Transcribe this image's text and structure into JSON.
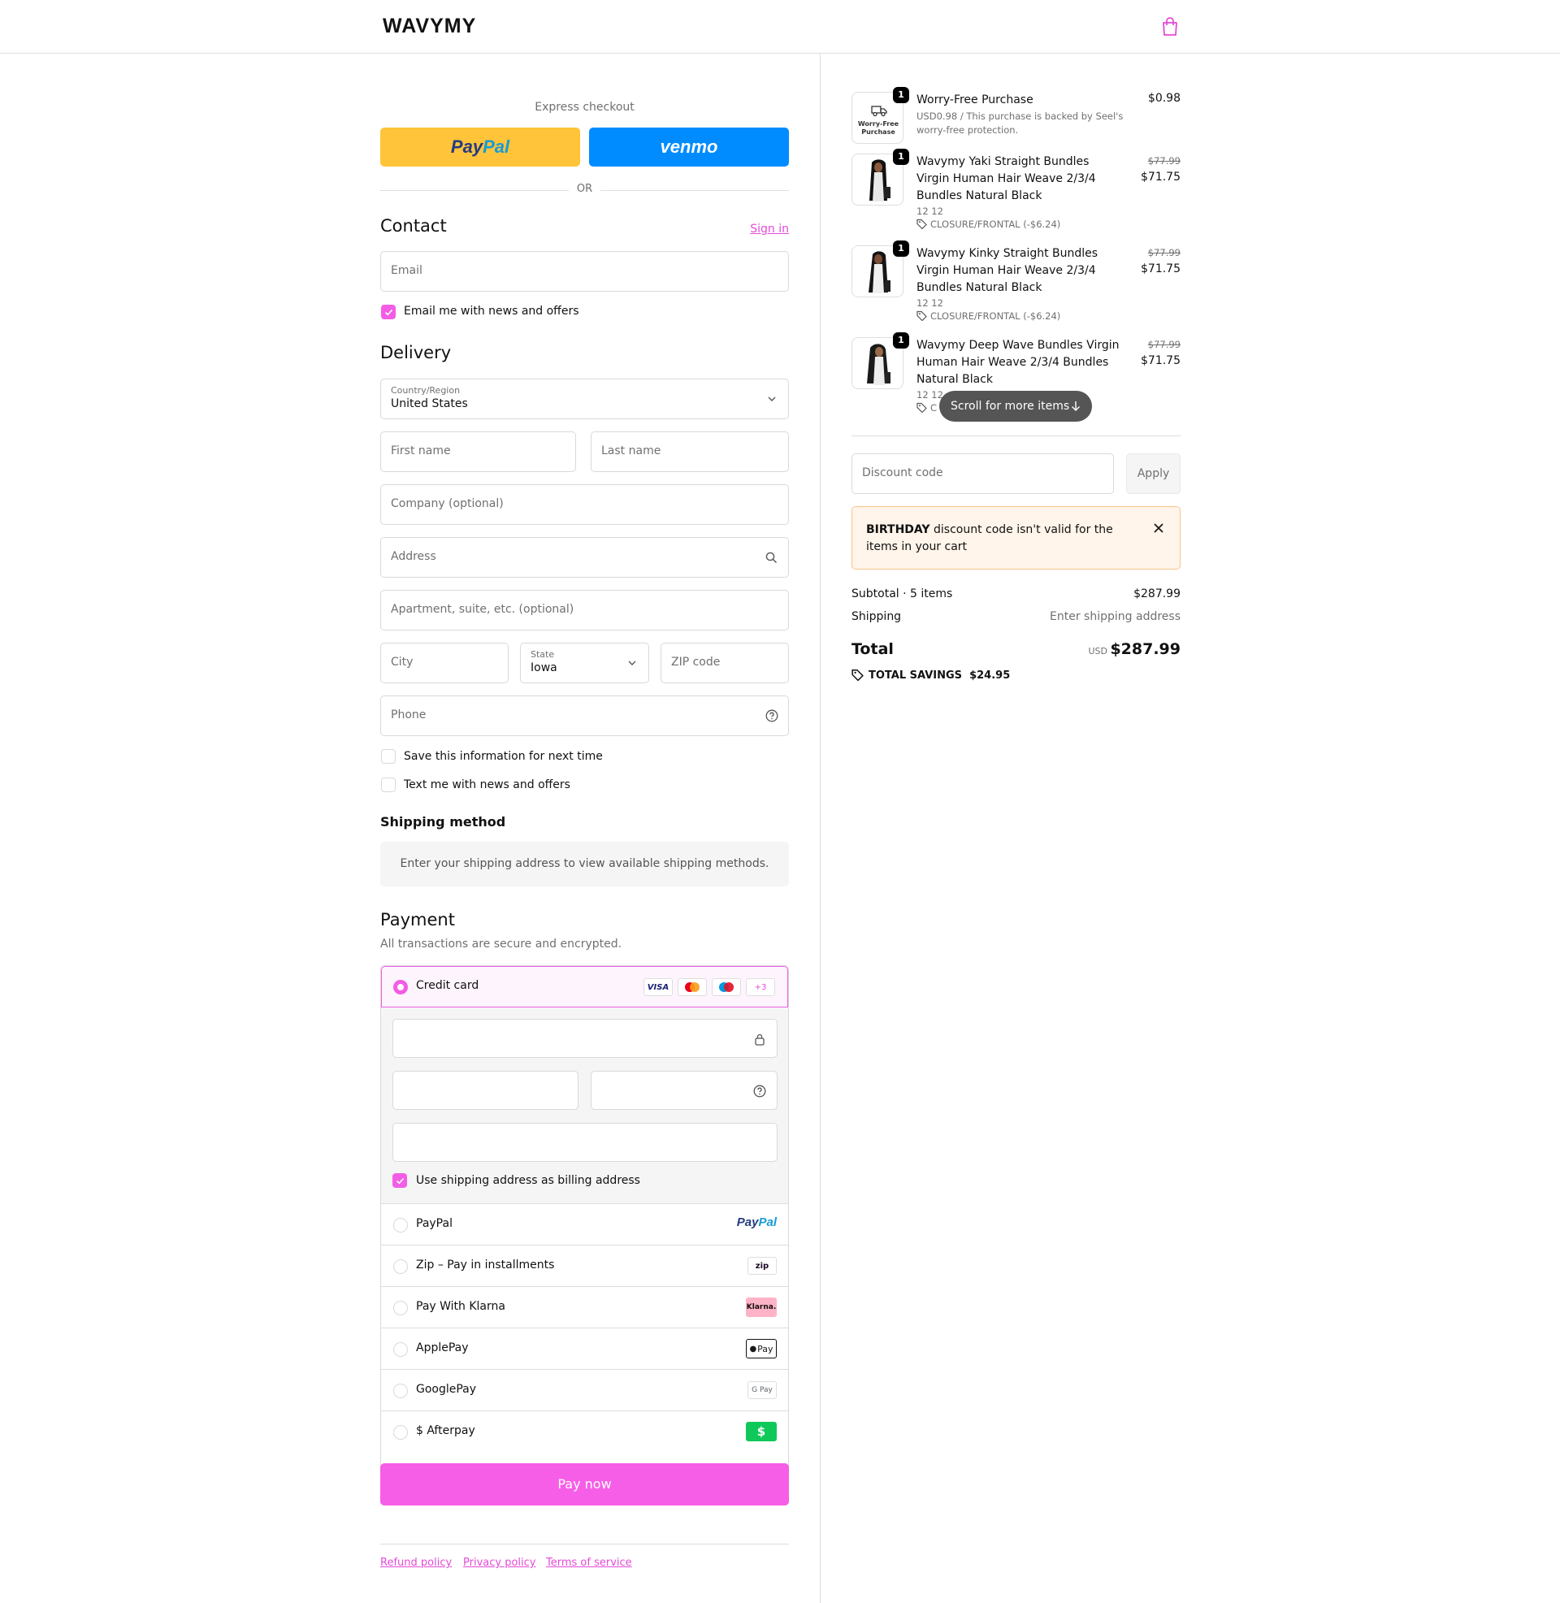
{
  "brand": {
    "name": "WAVYMY",
    "accent": "#f35de5"
  },
  "header": {
    "cart_icon": "shopping-bag-icon"
  },
  "express": {
    "title": "Express checkout",
    "paypal_label": "PayPal",
    "venmo_label": "venmo",
    "or_label": "OR"
  },
  "contact": {
    "title": "Contact",
    "signin_label": "Sign in",
    "email_placeholder": "Email",
    "newsletter_label": "Email me with news and offers",
    "newsletter_checked": true
  },
  "delivery": {
    "title": "Delivery",
    "country_label": "Country/Region",
    "country_value": "United States",
    "first_name_placeholder": "First name",
    "last_name_placeholder": "Last name",
    "company_placeholder": "Company (optional)",
    "address_placeholder": "Address",
    "apartment_placeholder": "Apartment, suite, etc. (optional)",
    "city_placeholder": "City",
    "state_label": "State",
    "state_value": "Iowa",
    "zip_placeholder": "ZIP code",
    "phone_placeholder": "Phone",
    "save_info_label": "Save this information for next time",
    "text_offers_label": "Text me with news and offers"
  },
  "shipping_method": {
    "title": "Shipping method",
    "note": "Enter your shipping address to view available shipping methods."
  },
  "payment": {
    "title": "Payment",
    "subtitle": "All transactions are secure and encrypted.",
    "credit_card_label": "Credit card",
    "card_badges": [
      "VISA",
      "mastercard",
      "maestro",
      "+3"
    ],
    "billing_label": "Use shipping address as billing address",
    "methods": [
      {
        "label": "PayPal",
        "logo": "PayPal"
      },
      {
        "label": "Zip – Pay in installments",
        "logo": "zip"
      },
      {
        "label": "Pay With Klarna",
        "logo": "Klarna."
      },
      {
        "label": "ApplePay",
        "logo": "Pay"
      },
      {
        "label": "GooglePay",
        "logo": "G Pay"
      },
      {
        "label": "$ Afterpay",
        "logo": "$"
      }
    ],
    "pay_now_label": "Pay now"
  },
  "footer": {
    "links": [
      "Refund policy",
      "Privacy policy",
      "Terms of service"
    ]
  },
  "cart": {
    "items": [
      {
        "name": "Worry-Free Purchase",
        "qty": "1",
        "sub": "USD0.98 / This purchase is backed by Seel's worry-free protection.",
        "price": "$0.98",
        "thumb_text": "Worry-Free Purchase"
      },
      {
        "name": "Wavymy Yaki Straight Bundles Virgin Human Hair Weave 2/3/4 Bundles Natural Black",
        "qty": "1",
        "variant": "12 12",
        "discount": "CLOSURE/FRONTAL (-$6.24)",
        "orig_price": "$77.99",
        "price": "$71.75"
      },
      {
        "name": "Wavymy Kinky Straight Bundles Virgin Human Hair Weave 2/3/4 Bundles Natural Black",
        "qty": "1",
        "variant": "12 12",
        "discount": "CLOSURE/FRONTAL (-$6.24)",
        "orig_price": "$77.99",
        "price": "$71.75"
      },
      {
        "name": "Wavymy Deep Wave Bundles Virgin Human Hair Weave 2/3/4 Bundles Natural Black",
        "qty": "1",
        "variant": "12 12",
        "discount_visible": "C",
        "orig_price": "$77.99",
        "price": "$71.75"
      }
    ],
    "scroll_label": "Scroll for more items",
    "discount_placeholder": "Discount code",
    "apply_label": "Apply",
    "warning_code": "BIRTHDAY",
    "warning_text": " discount code isn't valid for the items in your cart",
    "subtotal_label": "Subtotal · 5 items",
    "subtotal_value": "$287.99",
    "shipping_label": "Shipping",
    "shipping_value": "Enter shipping address",
    "total_label": "Total",
    "total_currency": "USD",
    "total_value": "$287.99",
    "savings_label": "TOTAL SAVINGS",
    "savings_value": "$24.95"
  }
}
